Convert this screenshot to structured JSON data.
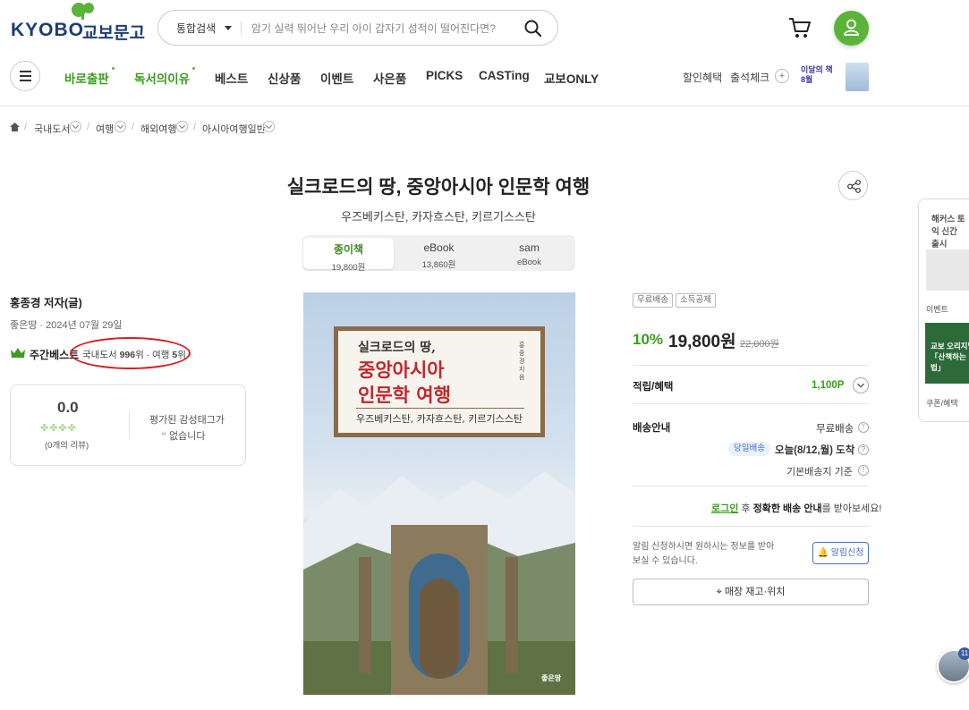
{
  "header": {
    "logo_en": "KYOBO",
    "logo_ko": "교보문고",
    "search_scope": "통합검색",
    "search_placeholder": "암기 실력 뛰어난 우리 아이 갑자기 성적이 떨어진다면?"
  },
  "nav": {
    "items": [
      {
        "label": "바로출판",
        "color": "#3a9d1f"
      },
      {
        "label": "독서의이유",
        "color": "#3a9d1f"
      },
      {
        "label": "베스트",
        "color": "#333333"
      },
      {
        "label": "신상품",
        "color": "#333333"
      },
      {
        "label": "이벤트",
        "color": "#333333"
      },
      {
        "label": "사은품",
        "color": "#333333"
      },
      {
        "label": "PICKS",
        "color": "#333333"
      },
      {
        "label": "CASTing",
        "color": "#333333"
      },
      {
        "label": "교보ONLY",
        "color": "#333333"
      }
    ],
    "right": {
      "discount": "할인혜택",
      "attendance": "출석체크",
      "plus": "+",
      "month_book_1": "이달의 책",
      "month_book_2": "8월"
    }
  },
  "breadcrumb": [
    "국내도서",
    "여행",
    "해외여행",
    "아시아여행일반"
  ],
  "product": {
    "title": "실크로드의 땅, 중앙아시아 인문학 여행",
    "subtitle": "우즈베키스탄, 카자흐스탄, 키르기스스탄",
    "formats": [
      {
        "label": "종이책",
        "price": "19,800원",
        "active": true
      },
      {
        "label": "eBook",
        "price": "13,860원",
        "active": false
      },
      {
        "label": "sam",
        "price": "eBook",
        "active": false
      }
    ],
    "author": "홍종경 저자(글)",
    "publisher_date": "좋은땅 · 2024년 07월 29일",
    "bestseller": {
      "label": "주간베스트",
      "rank_prefix": "국내도서",
      "rank_domestic": "996",
      "rank_unit": "위",
      "rank_mid": "· 여행",
      "rank_travel": "5",
      "rank_unit2": "위"
    },
    "review": {
      "score": "0.0",
      "clovers": "✤✤✤✤",
      "count": "(0개의 리뷰)",
      "emotion_line1": "평가된 감성태그가",
      "emotion_quote": "❝",
      "emotion_line2": "없습니다"
    },
    "cover": {
      "line1": "실크로드의 땅,",
      "line2": "중앙아시아",
      "line3": "인문학 여행",
      "author_vertical": "홍종경 지음",
      "line4": "우즈베키스탄, 카자흐스탄, 키르기스스탄",
      "publisher": "좋은땅"
    }
  },
  "purchase": {
    "badges": [
      "무료배송",
      "소득공제"
    ],
    "discount_rate": "10%",
    "price": "19,800원",
    "original_price": "22,000원",
    "points_label": "적립/혜택",
    "points_value": "1,100P",
    "delivery_label": "배송안내",
    "delivery_value": "무료배송",
    "same_day": "당일배송",
    "arrival": "오늘(8/12,월) 도착",
    "base_location": "기본배송지 기준",
    "login_link": "로그인",
    "login_mid": " 후 ",
    "login_bold": "정확한 배송 안내",
    "login_end": "를 받아보세요!",
    "alarm_text": "알림 신청하시면 원하시는 정보를 받아 보실 수 있습니다.",
    "alarm_button": "알림신청",
    "store_button": "매장 재고·위치"
  },
  "side": {
    "title": "해커스 토익 신간 출시",
    "event": "이벤트",
    "banner": "교보 오리지널 「산책하는 법」",
    "coupon": "쿠폰/혜택",
    "float_count": "11"
  }
}
